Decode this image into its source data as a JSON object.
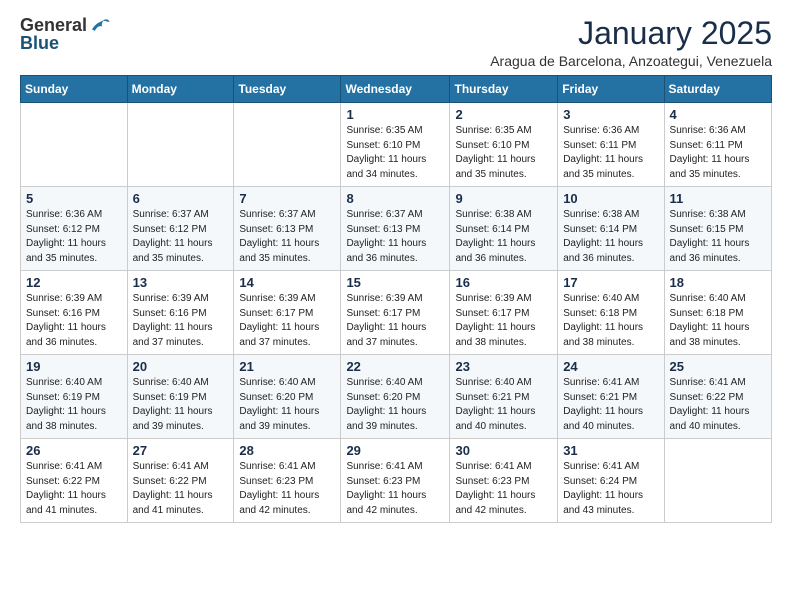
{
  "header": {
    "logo_general": "General",
    "logo_blue": "Blue",
    "month_title": "January 2025",
    "subtitle": "Aragua de Barcelona, Anzoategui, Venezuela"
  },
  "days_of_week": [
    "Sunday",
    "Monday",
    "Tuesday",
    "Wednesday",
    "Thursday",
    "Friday",
    "Saturday"
  ],
  "weeks": [
    [
      {
        "day": "",
        "info": ""
      },
      {
        "day": "",
        "info": ""
      },
      {
        "day": "",
        "info": ""
      },
      {
        "day": "1",
        "info": "Sunrise: 6:35 AM\nSunset: 6:10 PM\nDaylight: 11 hours\nand 34 minutes."
      },
      {
        "day": "2",
        "info": "Sunrise: 6:35 AM\nSunset: 6:10 PM\nDaylight: 11 hours\nand 35 minutes."
      },
      {
        "day": "3",
        "info": "Sunrise: 6:36 AM\nSunset: 6:11 PM\nDaylight: 11 hours\nand 35 minutes."
      },
      {
        "day": "4",
        "info": "Sunrise: 6:36 AM\nSunset: 6:11 PM\nDaylight: 11 hours\nand 35 minutes."
      }
    ],
    [
      {
        "day": "5",
        "info": "Sunrise: 6:36 AM\nSunset: 6:12 PM\nDaylight: 11 hours\nand 35 minutes."
      },
      {
        "day": "6",
        "info": "Sunrise: 6:37 AM\nSunset: 6:12 PM\nDaylight: 11 hours\nand 35 minutes."
      },
      {
        "day": "7",
        "info": "Sunrise: 6:37 AM\nSunset: 6:13 PM\nDaylight: 11 hours\nand 35 minutes."
      },
      {
        "day": "8",
        "info": "Sunrise: 6:37 AM\nSunset: 6:13 PM\nDaylight: 11 hours\nand 36 minutes."
      },
      {
        "day": "9",
        "info": "Sunrise: 6:38 AM\nSunset: 6:14 PM\nDaylight: 11 hours\nand 36 minutes."
      },
      {
        "day": "10",
        "info": "Sunrise: 6:38 AM\nSunset: 6:14 PM\nDaylight: 11 hours\nand 36 minutes."
      },
      {
        "day": "11",
        "info": "Sunrise: 6:38 AM\nSunset: 6:15 PM\nDaylight: 11 hours\nand 36 minutes."
      }
    ],
    [
      {
        "day": "12",
        "info": "Sunrise: 6:39 AM\nSunset: 6:16 PM\nDaylight: 11 hours\nand 36 minutes."
      },
      {
        "day": "13",
        "info": "Sunrise: 6:39 AM\nSunset: 6:16 PM\nDaylight: 11 hours\nand 37 minutes."
      },
      {
        "day": "14",
        "info": "Sunrise: 6:39 AM\nSunset: 6:17 PM\nDaylight: 11 hours\nand 37 minutes."
      },
      {
        "day": "15",
        "info": "Sunrise: 6:39 AM\nSunset: 6:17 PM\nDaylight: 11 hours\nand 37 minutes."
      },
      {
        "day": "16",
        "info": "Sunrise: 6:39 AM\nSunset: 6:17 PM\nDaylight: 11 hours\nand 38 minutes."
      },
      {
        "day": "17",
        "info": "Sunrise: 6:40 AM\nSunset: 6:18 PM\nDaylight: 11 hours\nand 38 minutes."
      },
      {
        "day": "18",
        "info": "Sunrise: 6:40 AM\nSunset: 6:18 PM\nDaylight: 11 hours\nand 38 minutes."
      }
    ],
    [
      {
        "day": "19",
        "info": "Sunrise: 6:40 AM\nSunset: 6:19 PM\nDaylight: 11 hours\nand 38 minutes."
      },
      {
        "day": "20",
        "info": "Sunrise: 6:40 AM\nSunset: 6:19 PM\nDaylight: 11 hours\nand 39 minutes."
      },
      {
        "day": "21",
        "info": "Sunrise: 6:40 AM\nSunset: 6:20 PM\nDaylight: 11 hours\nand 39 minutes."
      },
      {
        "day": "22",
        "info": "Sunrise: 6:40 AM\nSunset: 6:20 PM\nDaylight: 11 hours\nand 39 minutes."
      },
      {
        "day": "23",
        "info": "Sunrise: 6:40 AM\nSunset: 6:21 PM\nDaylight: 11 hours\nand 40 minutes."
      },
      {
        "day": "24",
        "info": "Sunrise: 6:41 AM\nSunset: 6:21 PM\nDaylight: 11 hours\nand 40 minutes."
      },
      {
        "day": "25",
        "info": "Sunrise: 6:41 AM\nSunset: 6:22 PM\nDaylight: 11 hours\nand 40 minutes."
      }
    ],
    [
      {
        "day": "26",
        "info": "Sunrise: 6:41 AM\nSunset: 6:22 PM\nDaylight: 11 hours\nand 41 minutes."
      },
      {
        "day": "27",
        "info": "Sunrise: 6:41 AM\nSunset: 6:22 PM\nDaylight: 11 hours\nand 41 minutes."
      },
      {
        "day": "28",
        "info": "Sunrise: 6:41 AM\nSunset: 6:23 PM\nDaylight: 11 hours\nand 42 minutes."
      },
      {
        "day": "29",
        "info": "Sunrise: 6:41 AM\nSunset: 6:23 PM\nDaylight: 11 hours\nand 42 minutes."
      },
      {
        "day": "30",
        "info": "Sunrise: 6:41 AM\nSunset: 6:23 PM\nDaylight: 11 hours\nand 42 minutes."
      },
      {
        "day": "31",
        "info": "Sunrise: 6:41 AM\nSunset: 6:24 PM\nDaylight: 11 hours\nand 43 minutes."
      },
      {
        "day": "",
        "info": ""
      }
    ]
  ]
}
